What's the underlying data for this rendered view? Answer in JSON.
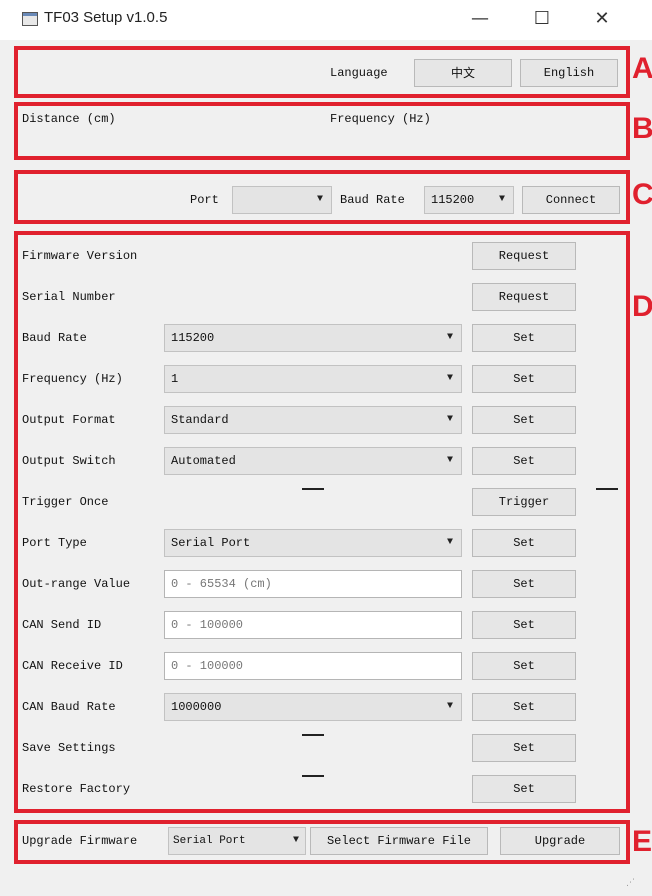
{
  "window": {
    "title": "TF03 Setup v1.0.5",
    "minimize": "—",
    "maximize": "☐",
    "close": "✕"
  },
  "sections": {
    "a": "A",
    "b": "B",
    "c": "C",
    "d": "D",
    "e": "E"
  },
  "language": {
    "label": "Language",
    "chinese": "中文",
    "english": "English"
  },
  "readout": {
    "distance_label": "Distance (cm)",
    "frequency_label": "Frequency (Hz)"
  },
  "connection": {
    "port_label": "Port",
    "port_value": "",
    "baud_label": "Baud Rate",
    "baud_value": "115200",
    "connect": "Connect"
  },
  "settings": {
    "firmware_version": {
      "label": "Firmware Version",
      "button": "Request"
    },
    "serial_number": {
      "label": "Serial Number",
      "button": "Request"
    },
    "baud_rate": {
      "label": "Baud Rate",
      "value": "115200",
      "button": "Set"
    },
    "frequency": {
      "label": "Frequency (Hz)",
      "value": "1",
      "button": "Set"
    },
    "output_format": {
      "label": "Output Format",
      "value": "Standard",
      "button": "Set"
    },
    "output_switch": {
      "label": "Output Switch",
      "value": "Automated",
      "button": "Set"
    },
    "trigger_once": {
      "label": "Trigger Once",
      "button": "Trigger"
    },
    "port_type": {
      "label": "Port Type",
      "value": "Serial Port",
      "button": "Set"
    },
    "out_range": {
      "label": "Out-range Value",
      "placeholder": "0 - 65534 (cm)",
      "button": "Set"
    },
    "can_send_id": {
      "label": "CAN Send ID",
      "placeholder": "0 - 100000",
      "button": "Set"
    },
    "can_receive_id": {
      "label": "CAN Receive ID",
      "placeholder": "0 - 100000",
      "button": "Set"
    },
    "can_baud_rate": {
      "label": "CAN Baud Rate",
      "value": "1000000",
      "button": "Set"
    },
    "save_settings": {
      "label": "Save Settings",
      "button": "Set"
    },
    "restore_factory": {
      "label": "Restore Factory",
      "button": "Set"
    }
  },
  "upgrade": {
    "label": "Upgrade Firmware",
    "port_value": "Serial Port",
    "select_file": "Select Firmware File",
    "upgrade": "Upgrade"
  }
}
